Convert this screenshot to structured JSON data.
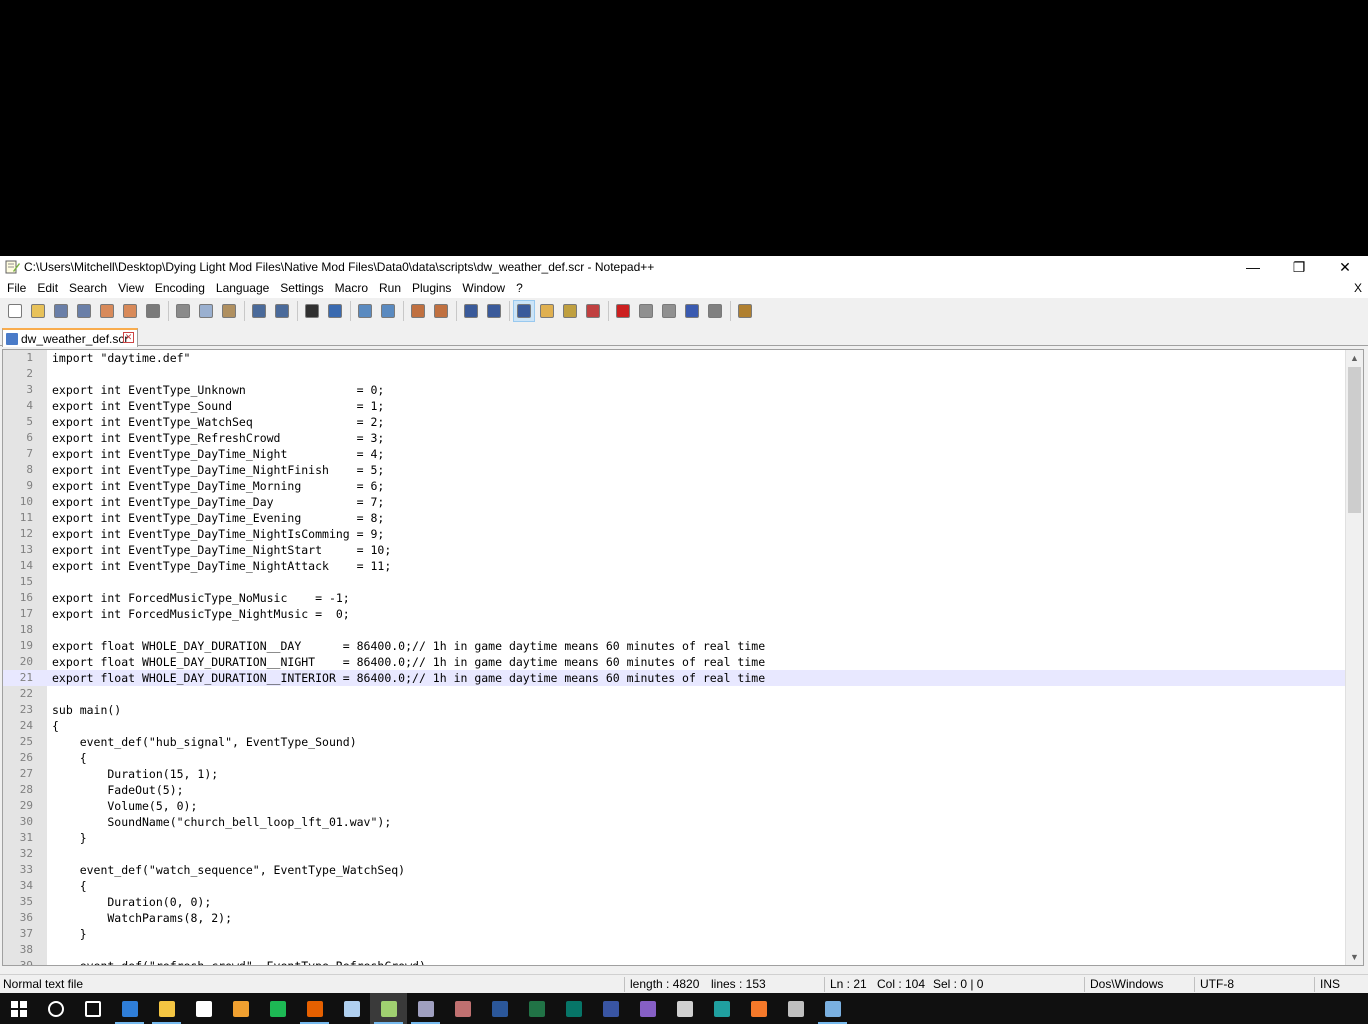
{
  "window": {
    "title": "C:\\Users\\Mitchell\\Desktop\\Dying Light Mod Files\\Native Mod Files\\Data0\\data\\scripts\\dw_weather_def.scr - Notepad++",
    "minimize_glyph": "—",
    "maximize_glyph": "❐",
    "close_glyph": "✕"
  },
  "menu": {
    "items": [
      "File",
      "Edit",
      "Search",
      "View",
      "Encoding",
      "Language",
      "Settings",
      "Macro",
      "Run",
      "Plugins",
      "Window",
      "?"
    ],
    "close_label": "X"
  },
  "toolbar": {
    "icons": [
      {
        "name": "new-file-icon",
        "color": "#ffffff"
      },
      {
        "name": "open-file-icon",
        "color": "#e8c25a"
      },
      {
        "name": "save-icon",
        "color": "#6a7fa8"
      },
      {
        "name": "save-all-icon",
        "color": "#6a7fa8"
      },
      {
        "name": "close-icon",
        "color": "#d88a5a"
      },
      {
        "name": "close-all-icon",
        "color": "#d88a5a"
      },
      {
        "name": "print-icon",
        "color": "#7a7a7a"
      },
      {
        "name": "cut-icon",
        "color": "#8a8a8a"
      },
      {
        "name": "copy-icon",
        "color": "#9ab0d0"
      },
      {
        "name": "paste-icon",
        "color": "#b09060"
      },
      {
        "name": "undo-icon",
        "color": "#4a6a9a"
      },
      {
        "name": "redo-icon",
        "color": "#4a6a9a"
      },
      {
        "name": "find-icon",
        "color": "#303030"
      },
      {
        "name": "replace-icon",
        "color": "#3a6ab0"
      },
      {
        "name": "zoom-in-icon",
        "color": "#5a8ac0"
      },
      {
        "name": "zoom-out-icon",
        "color": "#5a8ac0"
      },
      {
        "name": "sync-vertical-icon",
        "color": "#c07040"
      },
      {
        "name": "sync-horizontal-icon",
        "color": "#c07040"
      },
      {
        "name": "word-wrap-icon",
        "color": "#3a5a9a"
      },
      {
        "name": "show-all-chars-icon",
        "color": "#3a5a9a"
      },
      {
        "name": "indent-guide-icon",
        "color": "#3a5a9a"
      },
      {
        "name": "user-language-icon",
        "color": "#e0b050"
      },
      {
        "name": "doc-map-icon",
        "color": "#c0a040"
      },
      {
        "name": "function-list-icon",
        "color": "#c04040"
      },
      {
        "name": "record-macro-icon",
        "color": "#cc2020"
      },
      {
        "name": "stop-macro-icon",
        "color": "#909090"
      },
      {
        "name": "play-macro-icon",
        "color": "#909090"
      },
      {
        "name": "run-macro-multiple-icon",
        "color": "#3a5ab0"
      },
      {
        "name": "save-macro-icon",
        "color": "#808080"
      },
      {
        "name": "plugin-icon",
        "color": "#b08030"
      }
    ],
    "active_index": 20
  },
  "tabs": [
    {
      "label": "dw_weather_def.scr",
      "close_glyph": "✕"
    }
  ],
  "editor": {
    "current_line": 21,
    "lines": [
      "import \"daytime.def\"",
      "",
      "export int EventType_Unknown                = 0;",
      "export int EventType_Sound                  = 1;",
      "export int EventType_WatchSeq               = 2;",
      "export int EventType_RefreshCrowd           = 3;",
      "export int EventType_DayTime_Night          = 4;",
      "export int EventType_DayTime_NightFinish    = 5;",
      "export int EventType_DayTime_Morning        = 6;",
      "export int EventType_DayTime_Day            = 7;",
      "export int EventType_DayTime_Evening        = 8;",
      "export int EventType_DayTime_NightIsComming = 9;",
      "export int EventType_DayTime_NightStart     = 10;",
      "export int EventType_DayTime_NightAttack    = 11;",
      "",
      "export int ForcedMusicType_NoMusic    = -1;",
      "export int ForcedMusicType_NightMusic =  0;",
      "",
      "export float WHOLE_DAY_DURATION__DAY      = 86400.0;// 1h in game daytime means 60 minutes of real time",
      "export float WHOLE_DAY_DURATION__NIGHT    = 86400.0;// 1h in game daytime means 60 minutes of real time",
      "export float WHOLE_DAY_DURATION__INTERIOR = 86400.0;// 1h in game daytime means 60 minutes of real time",
      "",
      "sub main()",
      "{",
      "    event_def(\"hub_signal\", EventType_Sound)",
      "    {",
      "        Duration(15, 1);",
      "        FadeOut(5);",
      "        Volume(5, 0);",
      "        SoundName(\"church_bell_loop_lft_01.wav\");",
      "    }",
      "",
      "    event_def(\"watch_sequence\", EventType_WatchSeq)",
      "    {",
      "        Duration(0, 0);",
      "        WatchParams(8, 2);",
      "    }",
      "",
      "    event_def(\"refresh_crowd\", EventType_RefreshCrowd)"
    ]
  },
  "status": {
    "file_type": "Normal text file",
    "length": "length : 4820",
    "lines": "lines : 153",
    "ln": "Ln : 21",
    "col": "Col : 104",
    "sel": "Sel : 0 | 0",
    "eol": "Dos\\Windows",
    "encoding": "UTF-8",
    "mode": "INS"
  },
  "taskbar": {
    "items": [
      {
        "name": "start-button",
        "color": "#ffffff"
      },
      {
        "name": "cortana-icon",
        "color": "#ffffff"
      },
      {
        "name": "task-view-icon",
        "color": "#ffffff"
      },
      {
        "name": "edge-icon",
        "color": "#2f7ed8"
      },
      {
        "name": "file-explorer-icon",
        "color": "#f4c542"
      },
      {
        "name": "store-icon",
        "color": "#ffffff"
      },
      {
        "name": "photos-icon",
        "color": "#f0a030"
      },
      {
        "name": "spotify-icon",
        "color": "#1db954"
      },
      {
        "name": "firefox-icon",
        "color": "#e66000"
      },
      {
        "name": "notepad-icon",
        "color": "#b0d0f0"
      },
      {
        "name": "notepadpp-icon",
        "color": "#a0d070"
      },
      {
        "name": "app-icon-generic-1",
        "color": "#a0a0c0"
      },
      {
        "name": "app-icon-generic-2",
        "color": "#c07070"
      },
      {
        "name": "word-icon",
        "color": "#2b579a"
      },
      {
        "name": "excel-icon",
        "color": "#217346"
      },
      {
        "name": "publisher-icon",
        "color": "#077568"
      },
      {
        "name": "visio-icon",
        "color": "#3955a3"
      },
      {
        "name": "visual-studio-icon",
        "color": "#865fc5"
      },
      {
        "name": "audio-icon",
        "color": "#d0d0d0"
      },
      {
        "name": "terminal-icon",
        "color": "#20a0a0"
      },
      {
        "name": "blender-icon",
        "color": "#f5792a"
      },
      {
        "name": "app-icon-generic-3",
        "color": "#c0c0c0"
      },
      {
        "name": "steam-icon",
        "color": "#7ab0e0"
      }
    ],
    "running": [
      3,
      4,
      8,
      10,
      11,
      22
    ],
    "active_index": 10
  }
}
